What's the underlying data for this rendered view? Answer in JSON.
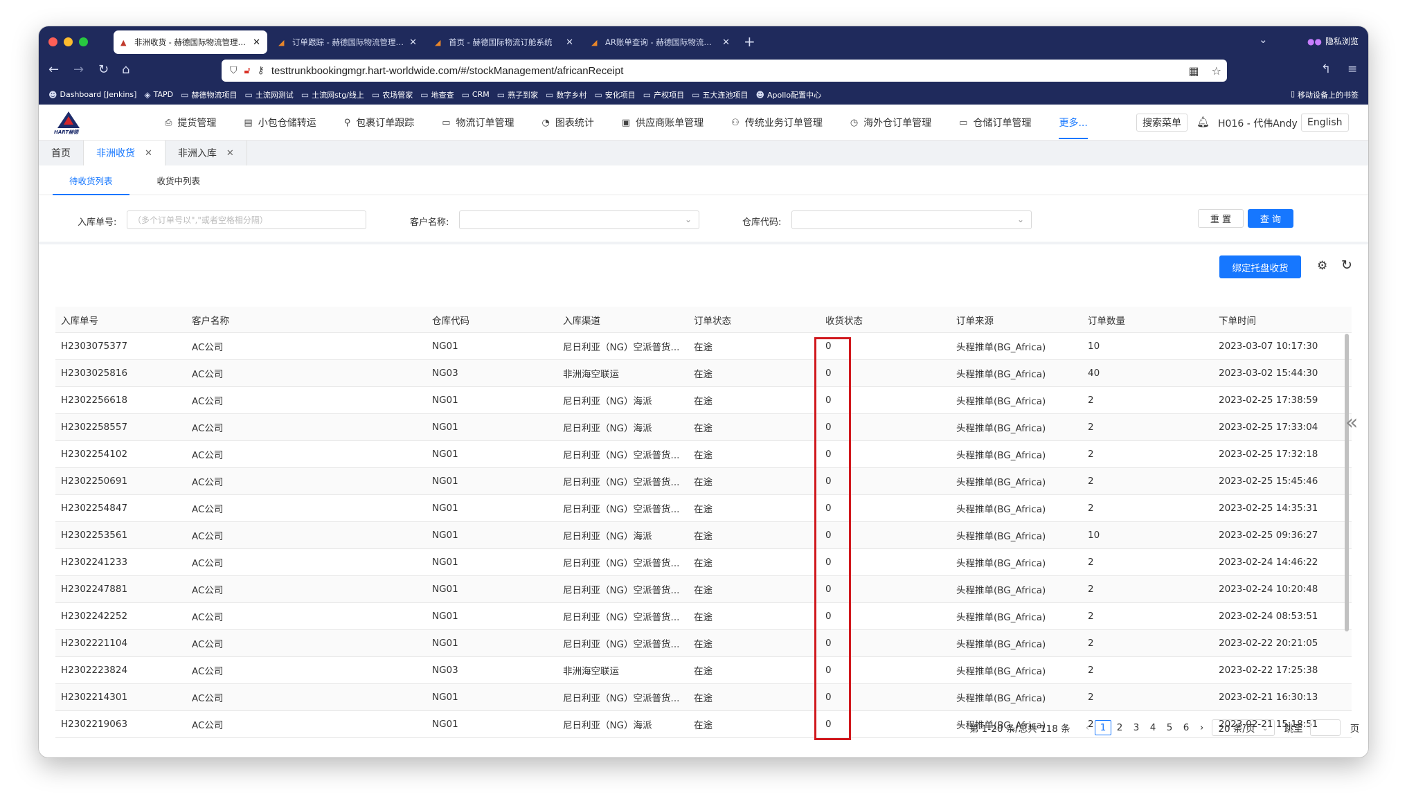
{
  "browser": {
    "tabs": [
      {
        "label": "非洲收货 - 赫德国际物流管理系统",
        "active": true
      },
      {
        "label": "订单跟踪 - 赫德国际物流管理系统",
        "active": false
      },
      {
        "label": "首页 - 赫德国际物流订舱系统",
        "active": false
      },
      {
        "label": "AR账单查询 - 赫德国际物流管理系统",
        "active": false
      }
    ],
    "private_label": "隐私浏览",
    "url": "testtrunkbookingmgr.hart-worldwide.com/#/stockManagement/africanReceipt",
    "bookmarks": [
      "Dashboard [Jenkins]",
      "TAPD",
      "赫德物流项目",
      "土流网测试",
      "土流网stg/线上",
      "农场管家",
      "地查查",
      "CRM",
      "燕子到家",
      "数字乡村",
      "安化项目",
      "产权项目",
      "五大连池项目",
      "Apollo配置中心"
    ],
    "mobile_bookmarks": "移动设备上的书签"
  },
  "app": {
    "logo_text": "HART赫德",
    "menu": [
      "提货管理",
      "小包仓储转运",
      "包裹订单跟踪",
      "物流订单管理",
      "图表统计",
      "供应商账单管理",
      "传统业务订单管理",
      "海外仓订单管理",
      "仓储订单管理"
    ],
    "menu_more": "更多...",
    "search_menu": "搜索菜单",
    "user": "H016 - 代伟Andy",
    "language": "English",
    "page_tabs": [
      {
        "label": "首页",
        "closable": false,
        "active": false
      },
      {
        "label": "非洲收货",
        "closable": true,
        "active": true
      },
      {
        "label": "非洲入库",
        "closable": true,
        "active": false
      }
    ],
    "sub_tabs": [
      "待收货列表",
      "收货中列表"
    ],
    "filters": {
      "order_no_label": "入库单号:",
      "order_no_placeholder": "（多个订单号以\",\"或者空格相分隔）",
      "customer_label": "客户名称:",
      "warehouse_label": "仓库代码:",
      "reset": "重 置",
      "query": "查 询"
    },
    "bind_button": "绑定托盘收货",
    "table": {
      "headers": [
        "入库单号",
        "客户名称",
        "仓库代码",
        "入库渠道",
        "订单状态",
        "收货状态",
        "订单来源",
        "订单数量",
        "下单时间"
      ],
      "rows": [
        [
          "H2303075377",
          "AC公司",
          "NG01",
          "尼日利亚（NG）空派普货...",
          "在途",
          "0",
          "头程推单(BG_Africa)",
          "10",
          "2023-03-07 10:17:30"
        ],
        [
          "H2303025816",
          "AC公司",
          "NG03",
          "非洲海空联运",
          "在途",
          "0",
          "头程推单(BG_Africa)",
          "40",
          "2023-03-02 15:44:30"
        ],
        [
          "H2302256618",
          "AC公司",
          "NG01",
          "尼日利亚（NG）海派",
          "在途",
          "0",
          "头程推单(BG_Africa)",
          "2",
          "2023-02-25 17:38:59"
        ],
        [
          "H2302258557",
          "AC公司",
          "NG01",
          "尼日利亚（NG）海派",
          "在途",
          "0",
          "头程推单(BG_Africa)",
          "2",
          "2023-02-25 17:33:04"
        ],
        [
          "H2302254102",
          "AC公司",
          "NG01",
          "尼日利亚（NG）空派普货...",
          "在途",
          "0",
          "头程推单(BG_Africa)",
          "2",
          "2023-02-25 17:32:18"
        ],
        [
          "H2302250691",
          "AC公司",
          "NG01",
          "尼日利亚（NG）空派普货...",
          "在途",
          "0",
          "头程推单(BG_Africa)",
          "2",
          "2023-02-25 15:45:46"
        ],
        [
          "H2302254847",
          "AC公司",
          "NG01",
          "尼日利亚（NG）空派普货...",
          "在途",
          "0",
          "头程推单(BG_Africa)",
          "2",
          "2023-02-25 14:35:31"
        ],
        [
          "H2302253561",
          "AC公司",
          "NG01",
          "尼日利亚（NG）海派",
          "在途",
          "0",
          "头程推单(BG_Africa)",
          "10",
          "2023-02-25 09:36:27"
        ],
        [
          "H2302241233",
          "AC公司",
          "NG01",
          "尼日利亚（NG）空派普货...",
          "在途",
          "0",
          "头程推单(BG_Africa)",
          "2",
          "2023-02-24 14:46:22"
        ],
        [
          "H2302247881",
          "AC公司",
          "NG01",
          "尼日利亚（NG）空派普货...",
          "在途",
          "0",
          "头程推单(BG_Africa)",
          "2",
          "2023-02-24 10:20:48"
        ],
        [
          "H2302242252",
          "AC公司",
          "NG01",
          "尼日利亚（NG）空派普货...",
          "在途",
          "0",
          "头程推单(BG_Africa)",
          "2",
          "2023-02-24 08:53:51"
        ],
        [
          "H2302221104",
          "AC公司",
          "NG01",
          "尼日利亚（NG）空派普货...",
          "在途",
          "0",
          "头程推单(BG_Africa)",
          "2",
          "2023-02-22 20:21:05"
        ],
        [
          "H2302223824",
          "AC公司",
          "NG03",
          "非洲海空联运",
          "在途",
          "0",
          "头程推单(BG_Africa)",
          "2",
          "2023-02-22 17:25:38"
        ],
        [
          "H2302214301",
          "AC公司",
          "NG01",
          "尼日利亚（NG）空派普货...",
          "在途",
          "0",
          "头程推单(BG_Africa)",
          "2",
          "2023-02-21 16:30:13"
        ],
        [
          "H2302219063",
          "AC公司",
          "NG01",
          "尼日利亚（NG）海派",
          "在途",
          "0",
          "头程推单(BG_Africa)",
          "2",
          "2023-02-21 15:18:51"
        ]
      ]
    },
    "pagination": {
      "summary": "第 1-20 条/总共 118 条",
      "pages": [
        "1",
        "2",
        "3",
        "4",
        "5",
        "6"
      ],
      "current": "1",
      "page_size": "20 条/页",
      "jump_label": "跳至",
      "page_suffix": "页"
    },
    "highlight_color": "#d0181d",
    "accent_color": "#1677ff"
  }
}
